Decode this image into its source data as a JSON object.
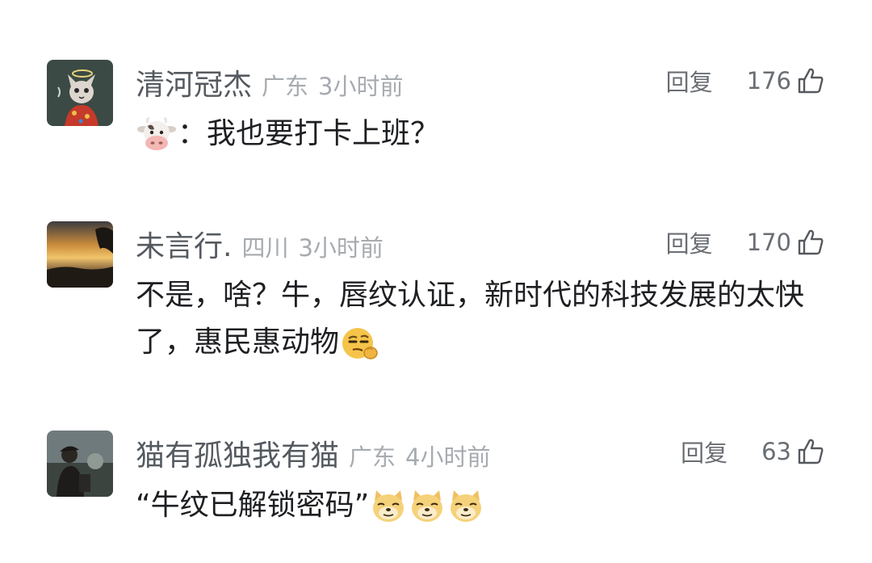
{
  "comments": [
    {
      "username": "清河冠杰",
      "location": "广东",
      "time": "3小时前",
      "reply_label": "回复",
      "likes": "176",
      "text_after_emoji": "：我也要打卡上班？",
      "emoji": "cow-face"
    },
    {
      "username": "未言行.",
      "location": "四川",
      "time": "3小时前",
      "reply_label": "回复",
      "likes": "170",
      "text": "不是，啥？牛，唇纹认证，新时代的科技发展的太快了，惠民惠动物",
      "emoji": "smug-face"
    },
    {
      "username": "猫有孤独我有猫",
      "location": "广东",
      "time": "4小时前",
      "reply_label": "回复",
      "likes": "63",
      "text": "“牛纹已解锁密码”",
      "emoji": "doge-face"
    }
  ],
  "colors": {
    "username": "#555a60",
    "meta": "#a7abb0",
    "text": "#1e1f22",
    "background": "#ffffff"
  }
}
